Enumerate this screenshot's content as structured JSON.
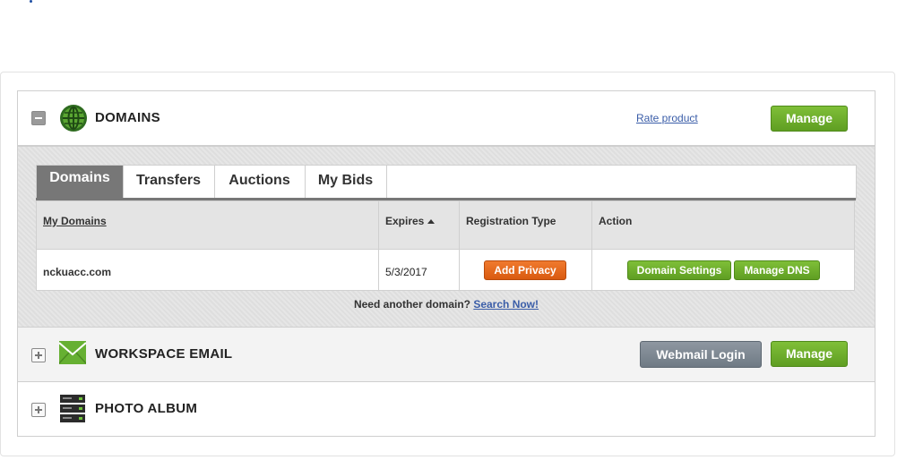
{
  "domains": {
    "title": "DOMAINS",
    "rate_label": "Rate product",
    "manage_label": "Manage",
    "tabs": [
      {
        "label": "Domains"
      },
      {
        "label": "Transfers"
      },
      {
        "label": "Auctions"
      },
      {
        "label": "My Bids"
      }
    ],
    "table": {
      "headers": {
        "my_domains": "My Domains",
        "expires": "Expires",
        "registration_type": "Registration Type",
        "action": "Action"
      },
      "rows": [
        {
          "domain": "nckuacc.com",
          "expires": "5/3/2017",
          "add_privacy": "Add Privacy",
          "domain_settings": "Domain Settings",
          "manage_dns": "Manage DNS"
        }
      ]
    },
    "need_text": "Need another domain?",
    "search_link": "Search Now!"
  },
  "workspace": {
    "title": "WORKSPACE EMAIL",
    "webmail_label": "Webmail Login",
    "manage_label": "Manage"
  },
  "photo": {
    "title": "PHOTO ALBUM"
  },
  "colors": {
    "accent_green": "#6aaa2a",
    "accent_orange": "#e56a1d",
    "link_blue": "#3a5da8",
    "tab_active": "#777777"
  },
  "icons": {
    "domains": "globe-icon",
    "workspace": "envelope-icon",
    "photo": "server-icon"
  }
}
